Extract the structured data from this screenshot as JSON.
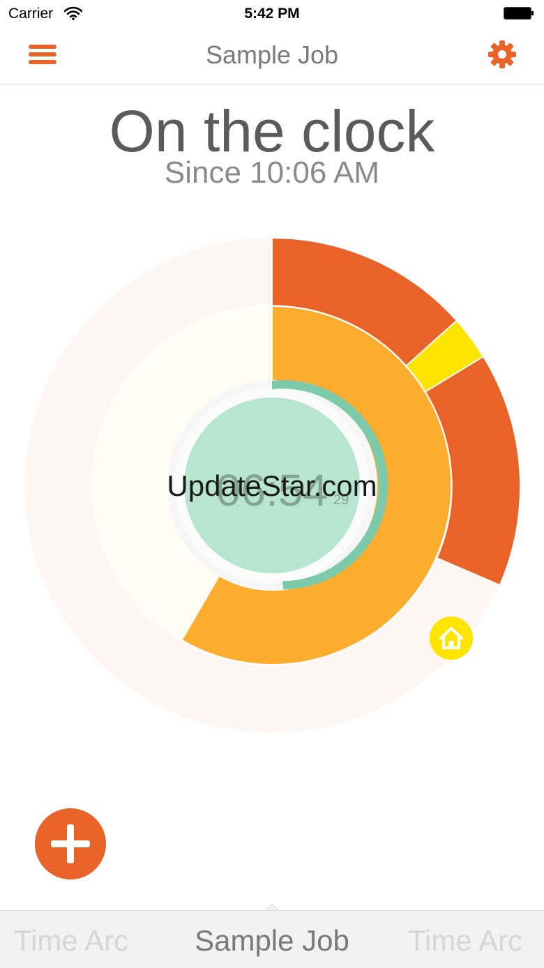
{
  "status_bar": {
    "carrier": "Carrier",
    "time": "5:42 PM"
  },
  "nav": {
    "title": "Sample Job",
    "menu_icon": "hamburger-menu-icon",
    "settings_icon": "gear-icon"
  },
  "status": {
    "title": "On the clock",
    "since": "Since 10:06 AM"
  },
  "clock": {
    "elapsed": "06:54",
    "seconds": "29"
  },
  "watermark": "UpdateStar.com",
  "chart_marker_icon": "home-icon",
  "add_button_icon": "plus-icon",
  "tabs": [
    {
      "label": "Time Arc",
      "active": false
    },
    {
      "label": "Sample Job",
      "active": true
    },
    {
      "label": "Time Arc",
      "active": false
    }
  ],
  "colors": {
    "accent": "#e96328",
    "outer_ring_bg": "#fdf6f2",
    "middle_ring_bg": "#fffcf3",
    "middle_ring_fill": "#fdad2d",
    "highlight_segment": "#ffe400",
    "inner_ring_fill": "#7ccaaa",
    "center_disc": "#b8e5cf"
  }
}
